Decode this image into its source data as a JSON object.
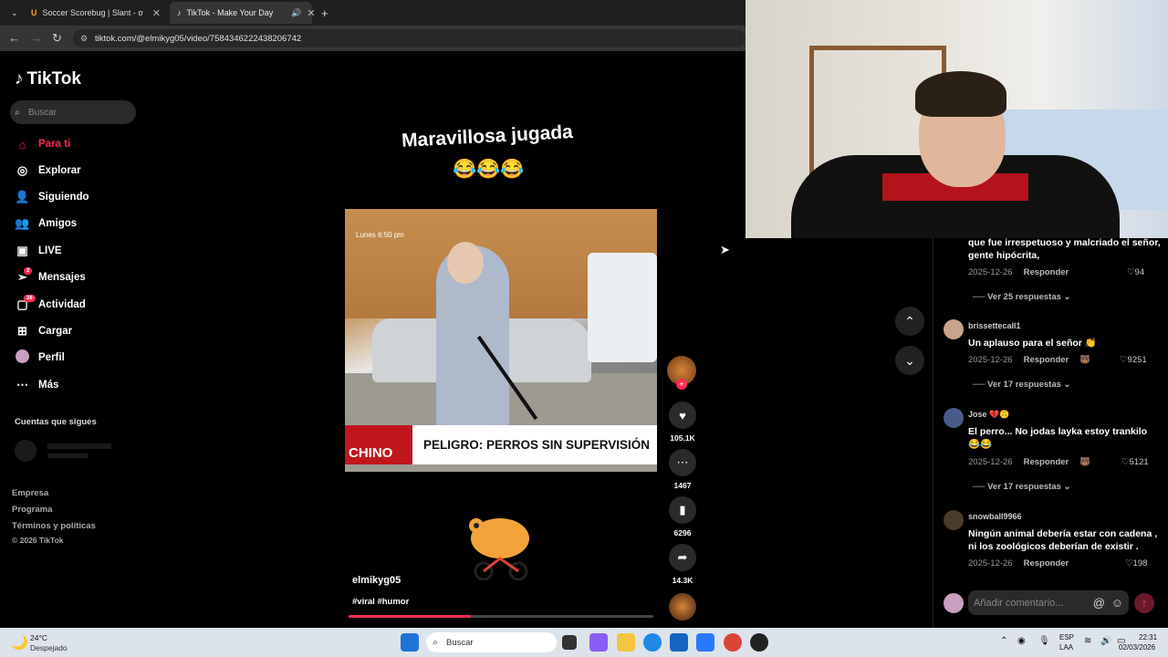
{
  "browser": {
    "tabs": [
      {
        "title": "Soccer Scorebug | Slant - overla"
      },
      {
        "title": "TikTok - Make Your Day"
      }
    ],
    "url": "tiktok.com/@elmikyg05/video/7584346222438206742"
  },
  "sidebar": {
    "logo": "TikTok",
    "search_placeholder": "Buscar",
    "items": [
      {
        "label": "Para ti"
      },
      {
        "label": "Explorar"
      },
      {
        "label": "Siguiendo"
      },
      {
        "label": "Amigos"
      },
      {
        "label": "LIVE"
      },
      {
        "label": "Mensajes",
        "badge": "2"
      },
      {
        "label": "Actividad",
        "badge": "26"
      },
      {
        "label": "Cargar"
      },
      {
        "label": "Perfil"
      },
      {
        "label": "Más"
      }
    ],
    "following_title": "Cuentas que sigues",
    "footer": [
      "Empresa",
      "Programa",
      "Términos y políticas",
      "© 2026 TikTok"
    ]
  },
  "video": {
    "caption": "Maravillosa jugada",
    "emojis": "😂😂😂",
    "timestamp_overlay": "Lunes 6:50 pm",
    "banner_brand": "CHINO",
    "banner_headline": "PELIGRO: PERROS SIN SUPERVISIÓN",
    "author": "elmikyg05",
    "hashtags": "#viral #humor",
    "progress_fraction": 0.4
  },
  "actions": {
    "likes": "105.1K",
    "comments": "1467",
    "saves": "6296",
    "shares": "14.3K"
  },
  "comments": {
    "top_partial": {
      "text1": "que fue irrespetuoso y malcriado el señor,",
      "text2": "gente hipócrita,",
      "date": "2025-12-26",
      "reply": "Responder",
      "likes": "94",
      "replies": "Ver 25 respuestas"
    },
    "items": [
      {
        "user": "brissettecall1",
        "text1": "Un aplauso para el señor 👏",
        "text2": "",
        "date": "2025-12-26",
        "reply": "Responder",
        "likes": "9251",
        "replies": "Ver 17 respuestas"
      },
      {
        "user": "Jose 💔🙃",
        "text1": "El perro... No jodas layka estoy trankilo",
        "text2": "😂😂",
        "date": "2025-12-26",
        "reply": "Responder",
        "likes": "5121",
        "replies": "Ver 17 respuestas"
      },
      {
        "user": "snowball9966",
        "text1": "Ningún animal debería estar con cadena ,",
        "text2": "ni los zoológicos deberían de existir .",
        "date": "2025-12-26",
        "reply": "Responder",
        "likes": "198",
        "replies": ""
      }
    ],
    "input_placeholder": "Añadir comentario..."
  },
  "taskbar": {
    "weather_temp": "24°C",
    "weather_desc": "Despejado",
    "search_label": "Buscar",
    "lang": "ESP",
    "layout": "LAA",
    "time": "22:31",
    "date": "02/03/2026"
  },
  "colors": {
    "accent": "#fe2c55",
    "background": "#000000"
  }
}
